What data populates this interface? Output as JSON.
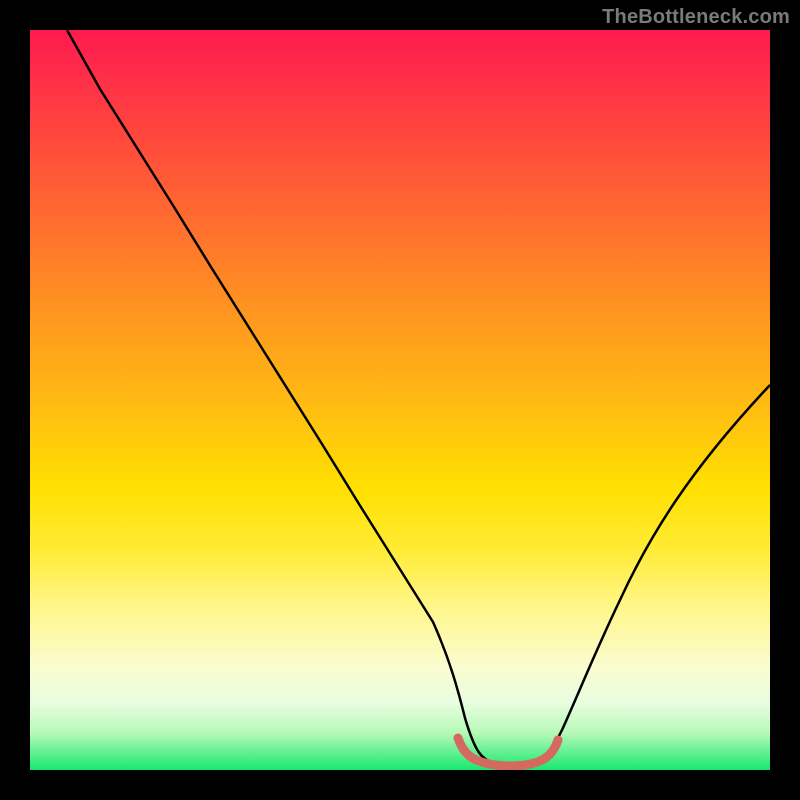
{
  "watermark": "TheBottleneck.com",
  "colors": {
    "background": "#000000",
    "gradient_top": "#ff1a4d",
    "gradient_bottom": "#18e870",
    "curve": "#000000",
    "valley_highlight": "#d4695f"
  },
  "chart_data": {
    "type": "line",
    "title": "",
    "xlabel": "",
    "ylabel": "",
    "xlim": [
      0,
      100
    ],
    "ylim": [
      0,
      100
    ],
    "series": [
      {
        "name": "bottleneck-curve",
        "x": [
          5,
          10,
          15,
          20,
          25,
          30,
          35,
          40,
          45,
          50,
          55,
          58,
          60,
          62,
          64,
          66,
          68,
          70,
          75,
          80,
          85,
          90,
          95,
          100
        ],
        "y": [
          100,
          92,
          84,
          76,
          68,
          60,
          52,
          44,
          36,
          28,
          20,
          12,
          7,
          4,
          2,
          1,
          1,
          2,
          4,
          8,
          16,
          26,
          38,
          52
        ]
      },
      {
        "name": "valley-highlight",
        "x": [
          58,
          60,
          62,
          64,
          66,
          68,
          70
        ],
        "y": [
          4,
          2.5,
          1.5,
          1,
          1,
          1.5,
          3
        ]
      }
    ]
  }
}
